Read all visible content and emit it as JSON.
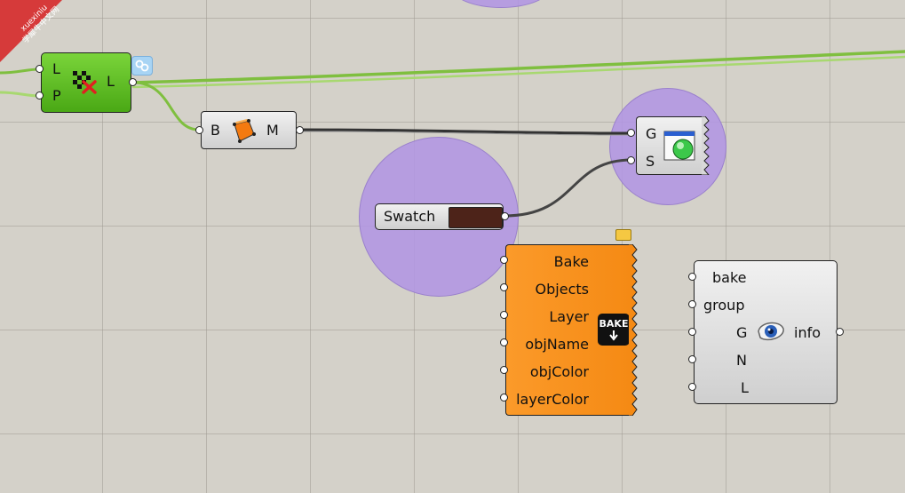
{
  "watermark": {
    "line1": "xuexiniu",
    "line2": "学犀牛中文网"
  },
  "colors": {
    "canvas": "#d4d1c9",
    "halo": "#b094e4",
    "green_node": "#5fbe22",
    "bake_node": "#f7941d",
    "swatch_color": "#4d2319"
  },
  "nodes": {
    "green": {
      "inputs": [
        "L",
        "P"
      ],
      "output": "L",
      "icon": "checker-cross-icon",
      "badge_icon": "preview-badge-icon"
    },
    "box": {
      "input": "B",
      "output": "M",
      "icon": "orange-box-icon"
    },
    "preview": {
      "inputs": [
        "G",
        "S"
      ],
      "icon": "sphere-preview-icon"
    },
    "swatch": {
      "label": "Swatch"
    },
    "bake": {
      "inputs": [
        "Bake",
        "Objects",
        "Layer",
        "objName",
        "objColor",
        "layerColor"
      ],
      "icon_label": "BAKE",
      "icon": "bake-icon"
    },
    "info": {
      "inputs": [
        "bake",
        "group",
        "G",
        "N",
        "L"
      ],
      "output": "info",
      "icon": "eye-icon"
    }
  }
}
